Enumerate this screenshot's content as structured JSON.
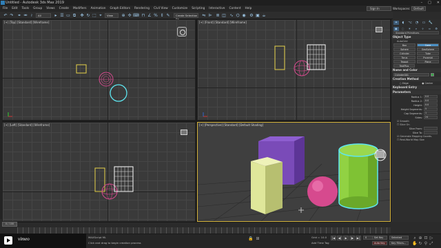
{
  "window": {
    "title": "Untitled - Autodesk 3ds Max 2019",
    "controls": [
      "–",
      "□",
      "✕"
    ]
  },
  "menu": [
    "File",
    "Edit",
    "Tools",
    "Group",
    "Views",
    "Create",
    "Modifiers",
    "Animation",
    "Graph Editors",
    "Rendering",
    "Civil View",
    "Customize",
    "Scripting",
    "Interactive",
    "Content",
    "Help"
  ],
  "account": {
    "sign_in_label": "Sign In",
    "workspace_label": "Workspaces:",
    "workspace_value": "Default"
  },
  "toolbar": {
    "selection_filter": "All",
    "viewport_dropdown": "View",
    "selection_set": "Create Selection Se"
  },
  "viewports": {
    "top": {
      "label": "[+] [Top] [Standard] [Wireframe]"
    },
    "front": {
      "label": "[+] [Front] [Standard] [Wireframe]"
    },
    "left": {
      "label": "[+] [Left] [Standard] [Wireframe]"
    },
    "perspective": {
      "label": "[+] [Perspective] [Standard] [Default Shading]"
    }
  },
  "command_panel": {
    "tabs_icons": [
      "create-icon",
      "modify-icon",
      "hierarchy-icon",
      "motion-icon",
      "display-icon",
      "utilities-icon"
    ],
    "category_dropdown": "Standard Primitives",
    "object_type": {
      "header": "Object Type",
      "autogrid": "AutoGrid",
      "buttons": [
        "Box",
        "Cone",
        "Sphere",
        "GeoSphere",
        "Cylinder",
        "Tube",
        "Torus",
        "Pyramid",
        "Teapot",
        "Plane",
        "TextPlus"
      ],
      "selected": "Cone"
    },
    "name_color": {
      "header": "Name and Color",
      "name_value": "Cylinder001",
      "color": "#3aa84a"
    },
    "creation_method": {
      "header": "Creation Method",
      "options": [
        "Edge",
        "Center"
      ],
      "selected": "Center"
    },
    "keyboard_entry": {
      "header": "Keyboard Entry"
    },
    "parameters": {
      "header": "Parameters",
      "fields": [
        {
          "label": "Radius 1:",
          "value": "0.0"
        },
        {
          "label": "Radius 2:",
          "value": "0.0"
        },
        {
          "label": "Height:",
          "value": "0.0"
        },
        {
          "label": "Height Segments:",
          "value": "5"
        },
        {
          "label": "Cap Segments:",
          "value": "1"
        },
        {
          "label": "Sides:",
          "value": "24"
        }
      ],
      "checks": [
        "Smooth",
        "Slice On",
        "Slice From:",
        "Slice To:",
        "Generate Mapping Coords.",
        "Real-World Map Size"
      ]
    }
  },
  "timeline": {
    "slider": "0 / 100"
  },
  "status": {
    "script_label": "MAXScript Mi.",
    "message": "Click and drag to begin creation process",
    "grid": "Grid = 10.0",
    "add_time_tag": "Add Time Tag",
    "auto_key": "Auto Key",
    "selected": "Selected",
    "set_key": "Set Key",
    "key_filters": "Key Filters...",
    "frame": "0",
    "playback": [
      "|◀",
      "◀|",
      "▶",
      "|▶",
      "▶|"
    ]
  },
  "video": {
    "brand": "vimeo"
  },
  "colors": {
    "selection_yellow": "#e6d24a",
    "sphere_pink": "#d64a8e",
    "cylinder_green": "#7fc234",
    "box_purple": "#7a4bb8",
    "box_yellow": "#dfe79a",
    "highlight_cyan": "#5ee6f0"
  }
}
